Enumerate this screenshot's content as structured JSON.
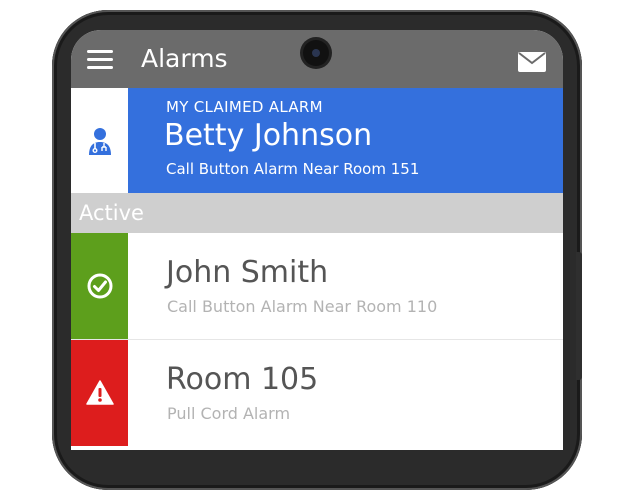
{
  "app_bar": {
    "title": "Alarms",
    "menu_icon": "hamburger-menu-icon",
    "mail_icon": "envelope-icon",
    "background": "#6b6b6b"
  },
  "claimed_alarm": {
    "kicker": "MY CLAIMED ALARM",
    "name": "Betty Johnson",
    "description": "Call Button Alarm Near Room 151",
    "icon": "doctor-icon",
    "accent": "#3470dd"
  },
  "section": {
    "label": "Active"
  },
  "alarms": [
    {
      "name": "John Smith",
      "description": "Call Button Alarm Near Room 110",
      "icon": "checkmark-circle-icon",
      "status_color": "#5d9f1c"
    },
    {
      "name": "Room 105",
      "description": "Pull Cord Alarm",
      "icon": "warning-triangle-icon",
      "status_color": "#dd1d1d"
    }
  ]
}
